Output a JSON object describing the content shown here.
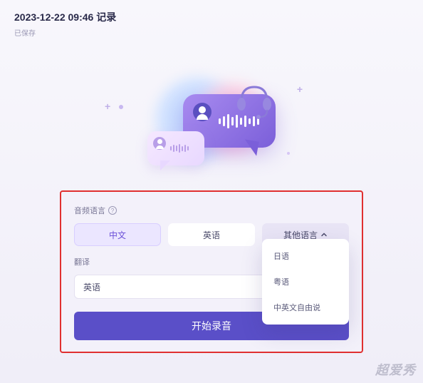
{
  "header": {
    "title": "2023-12-22 09:46 记录",
    "status": "已保存"
  },
  "panel": {
    "audio_lang_label": "音频语言",
    "pills": {
      "chinese": "中文",
      "english": "英语",
      "other": "其他语言"
    },
    "translate_label": "翻译",
    "translate_value": "英语",
    "start_button": "开始录音",
    "dropdown": {
      "item1": "日语",
      "item2": "粤语",
      "item3": "中英文自由说"
    }
  },
  "watermark": "超爱秀"
}
